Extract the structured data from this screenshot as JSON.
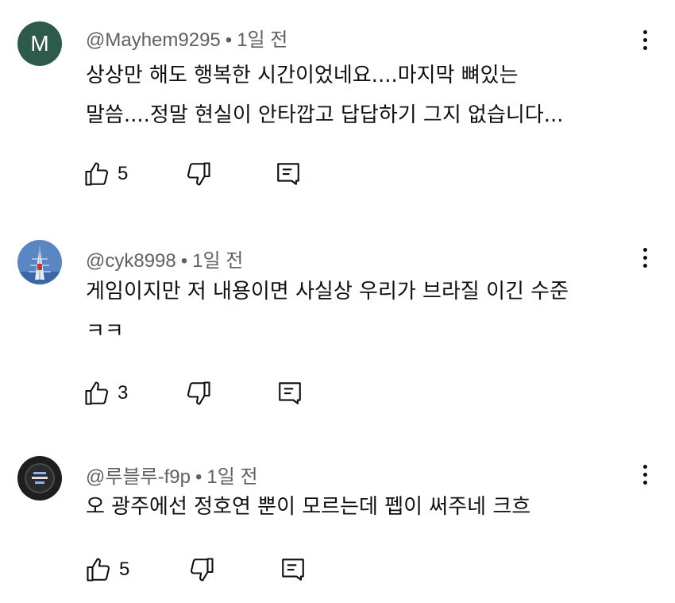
{
  "comments": [
    {
      "author": "@Mayhem9295",
      "time": "1일 전",
      "avatar_letter": "M",
      "lines": [
        "상상만 해도 행복한 시간이었네요....마지막 뼈있는",
        "말씀....정말 현실이 안타깝고 답답하기 그지 없습니다..."
      ],
      "likes": "5"
    },
    {
      "author": "@cyk8998",
      "time": "1일 전",
      "lines": [
        "게임이지만 저 내용이면 사실상 우리가 브라질 이긴 수준",
        "ㅋㅋ"
      ],
      "likes": "3"
    },
    {
      "author": "@루블루-f9p",
      "time": "1일 전",
      "lines": [
        "오 광주에선 정호연 뿐이 모르는데 펩이 써주네 크흐"
      ],
      "likes": "5"
    }
  ],
  "separator": "•",
  "icons": {
    "like": "thumb-up-icon",
    "dislike": "thumb-down-icon",
    "reply": "reply-comment-icon",
    "more": "more-vertical-icon"
  },
  "colors": {
    "text": "#0f0f0f",
    "meta": "#606060",
    "avatar_m": "#2e5a4c"
  }
}
